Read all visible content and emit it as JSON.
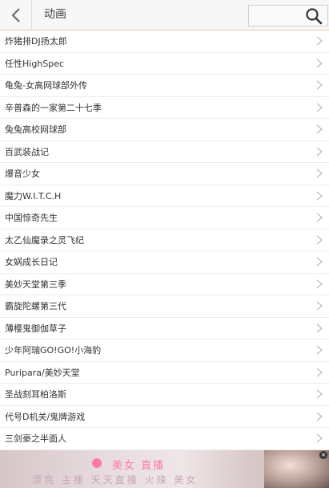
{
  "header": {
    "title": "动画",
    "search_placeholder": ""
  },
  "list": {
    "items": [
      "炸猪排DJ扬太郎",
      "任性HighSpec",
      "龟兔-女高网球部外传",
      "辛普森的一家第二十七季",
      "兔兔高校网球部",
      "百武装战记",
      "爆音少女",
      "魔力W.I.T.C.H",
      "中国惊奇先生",
      "太乙仙魔录之灵飞纪",
      "女娲成长日记",
      "美妙天堂第三季",
      "霸旋陀螺第三代",
      "薄樱鬼御伽草子",
      "少年阿瑞GO!GO!小海豹",
      "Puripara/美妙天堂",
      "圣战刻耳柏洛斯",
      "代号D机关/鬼牌游戏",
      "三剑豪之半面人"
    ]
  },
  "ad": {
    "line1": "美女 直播",
    "line2": "漂亮 主播   天天直播 火辣 美女",
    "close": "×"
  },
  "colors": {
    "header_bg": "#f7f7f7",
    "header_border": "#e3c9b6",
    "accent_pink": "#ff7aa6"
  }
}
